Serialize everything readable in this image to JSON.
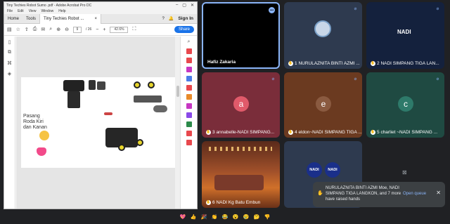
{
  "acrobat": {
    "title": "Tiny Techies Robot Sumo .pdf - Adobe Acrobat Pro DC",
    "menu": [
      "File",
      "Edit",
      "View",
      "Window",
      "Help"
    ],
    "tabs": {
      "home": "Home",
      "tools": "Tools",
      "doc": "Tiny Techies Robot ..."
    },
    "signin": "Sign In",
    "page_current": "9",
    "page_total": "/ 26",
    "zoom": "42.6%",
    "share": "Share",
    "page_text": [
      "Pasang",
      "Roda Kiri",
      "dan Kanan"
    ]
  },
  "meet": {
    "tiles": [
      {
        "name": "Hafiz Zakaria"
      },
      {
        "name": "NURULAZNITA BINTI AZMI ...",
        "num": "1"
      },
      {
        "name": "NADI SIMPANG TIGA LAN...",
        "num": "2",
        "logo": "NADI"
      },
      {
        "name": "annabelle-NADI SIMPANG...",
        "num": "3",
        "initial": "a"
      },
      {
        "name": "eldon~NADI SIMPANG TIGA ...",
        "num": "4",
        "initial": "e"
      },
      {
        "name": "charliet ~NADI SIMPANG ...",
        "num": "5",
        "initial": "c"
      },
      {
        "name": "NADI Kg Batu Embun",
        "num": "6"
      },
      {
        "logo1": "NADI",
        "logo2": "NADI"
      }
    ],
    "toast": {
      "text": "NURULAZNITA BINTI AZMI Moe, NADI SIMPANG TIGA LANGKON, and 7 more have raised hands",
      "open": "Open queue"
    },
    "reactions": [
      "sparkling-heart",
      "thumbs-up",
      "party",
      "clap",
      "laugh",
      "surprised",
      "crying",
      "thinking",
      "thumbs-down"
    ]
  },
  "colors": {
    "tile_a": "#7a2d3a",
    "tile_e": "#6b3a20",
    "tile_c": "#1f4a42",
    "tile_nadi": "#2e3a4f",
    "active_border": "#8ab4f8"
  }
}
